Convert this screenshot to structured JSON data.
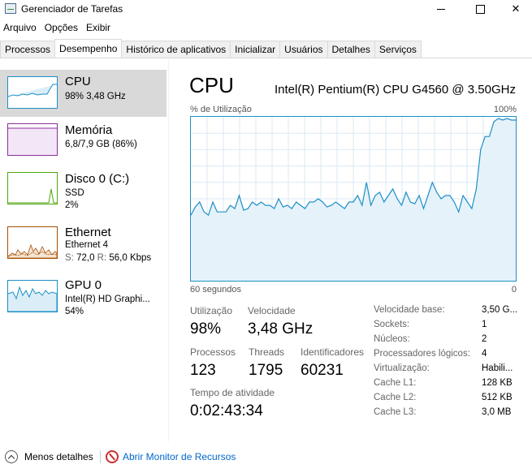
{
  "window": {
    "title": "Gerenciador de Tarefas",
    "minimize_label": "",
    "maximize_label": "",
    "close_label": "✕"
  },
  "menu": [
    "Arquivo",
    "Opções",
    "Exibir"
  ],
  "tabs": [
    {
      "label": "Processos",
      "active": false
    },
    {
      "label": "Desempenho",
      "active": true
    },
    {
      "label": "Histórico de aplicativos",
      "active": false
    },
    {
      "label": "Inicializar",
      "active": false
    },
    {
      "label": "Usuários",
      "active": false
    },
    {
      "label": "Detalhes",
      "active": false
    },
    {
      "label": "Serviços",
      "active": false
    }
  ],
  "sidebar": {
    "cpu": {
      "title": "CPU",
      "line1": "98%  3,48 GHz",
      "color": "#1c8fc6"
    },
    "memory": {
      "title": "Memória",
      "line1": "6,8/7,9 GB (86%)",
      "color": "#8b2f9c"
    },
    "disk": {
      "title": "Disco 0 (C:)",
      "line1": "SSD",
      "line2": "2%",
      "color": "#4da60c"
    },
    "ethernet": {
      "title": "Ethernet",
      "line1": "Ethernet 4",
      "send_label": "S:",
      "send_value": "72,0",
      "recv_label": "R:",
      "recv_value": "56,0 Kbps",
      "color": "#a74f01"
    },
    "gpu": {
      "title": "GPU 0",
      "line1": "Intel(R) HD Graphi...",
      "line2": "54%",
      "color": "#1c8fc6"
    }
  },
  "main": {
    "title": "CPU",
    "model": "Intel(R) Pentium(R) CPU G4560 @ 3.50GHz",
    "y_label": "% de Utilização",
    "y_max_label": "100%",
    "x_left_label": "60 segundos",
    "x_right_label": "0",
    "stats": {
      "utilization_label": "Utilização",
      "utilization_value": "98%",
      "speed_label": "Velocidade",
      "speed_value": "3,48 GHz",
      "processes_label": "Processos",
      "processes_value": "123",
      "threads_label": "Threads",
      "threads_value": "1795",
      "handles_label": "Identificadores",
      "handles_value": "60231",
      "uptime_label": "Tempo de atividade",
      "uptime_value": "0:02:43:34"
    },
    "specs": [
      {
        "label": "Velocidade base:",
        "value": "3,50 G..."
      },
      {
        "label": "Sockets:",
        "value": "1"
      },
      {
        "label": "Núcleos:",
        "value": "2"
      },
      {
        "label": "Processadores lógicos:",
        "value": "4"
      },
      {
        "label": "Virtualização:",
        "value": "Habili..."
      },
      {
        "label": "Cache L1:",
        "value": "128 KB"
      },
      {
        "label": "Cache L2:",
        "value": "512 KB"
      },
      {
        "label": "Cache L3:",
        "value": "3,0 MB"
      }
    ],
    "cpu_history_percent": [
      40,
      45,
      48,
      42,
      40,
      48,
      42,
      42,
      42,
      46,
      44,
      52,
      43,
      44,
      48,
      46,
      48,
      46,
      46,
      44,
      50,
      45,
      46,
      44,
      48,
      46,
      44,
      48,
      48,
      50,
      48,
      45,
      46,
      48,
      46,
      44,
      48,
      48,
      52,
      46,
      60,
      46,
      52,
      54,
      48,
      52,
      56,
      50,
      46,
      54,
      48,
      47,
      52,
      44,
      52,
      60,
      54,
      50,
      52,
      52,
      48,
      42,
      52,
      48,
      44,
      56,
      80,
      88,
      88,
      97,
      99,
      98,
      99,
      98,
      98
    ]
  },
  "footer": {
    "less_details": "Menos detalhes",
    "resource_monitor": "Abrir Monitor de Recursos"
  }
}
